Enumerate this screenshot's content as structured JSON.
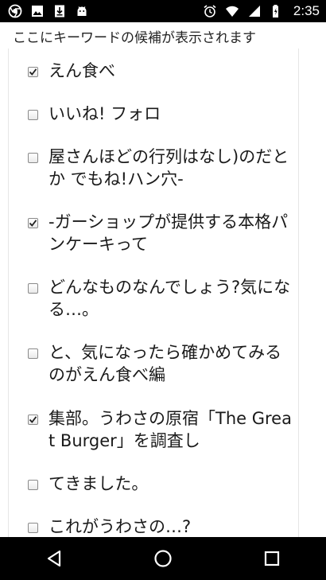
{
  "status_bar": {
    "time": "2:35",
    "left_icons": [
      "chrome-icon",
      "image-icon",
      "download-icon",
      "android-icon"
    ],
    "right_icons": [
      "alarm-icon",
      "wifi-icon",
      "signal-icon",
      "battery-icon"
    ]
  },
  "hint": "ここにキーワードの候補が表示されます",
  "items": [
    {
      "label": "えん食べ",
      "checked": true
    },
    {
      "label": "いいね! フォロ",
      "checked": false
    },
    {
      "label": "屋さんほどの行列はなし)のだとか でもね!ハン穴-",
      "checked": false
    },
    {
      "label": "-ガーショップが提供する本格パンケーキって",
      "checked": true
    },
    {
      "label": "どんなものなんでしょう?気になる…。",
      "checked": false
    },
    {
      "label": "と、気になったら確かめてみるのがえん食べ編",
      "checked": false
    },
    {
      "label": "集部。うわさの原宿「The Great Burger」を調査し",
      "checked": true
    },
    {
      "label": "てきました。",
      "checked": false
    },
    {
      "label": "これがうわさの…?",
      "checked": false
    }
  ],
  "nav": [
    "back-icon",
    "home-icon",
    "recents-icon"
  ],
  "colors": {
    "status_bar": "#000000",
    "nav_bar": "#000000",
    "background": "#ffffff"
  }
}
